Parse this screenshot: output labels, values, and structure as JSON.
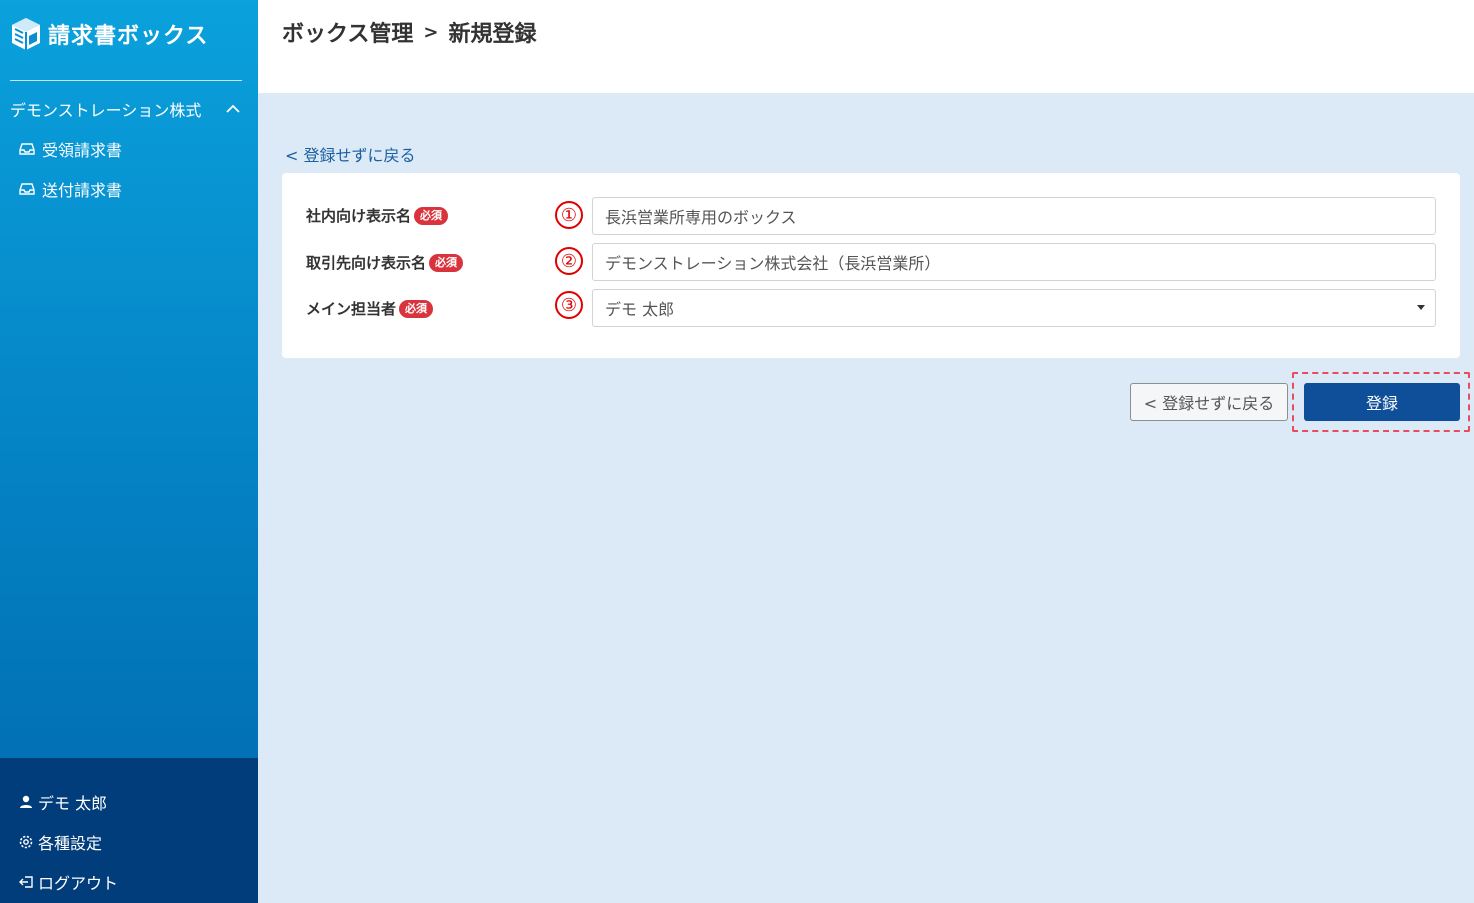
{
  "brand": {
    "name": "請求書ボックス",
    "logo_icon": "box-logo-icon"
  },
  "sidebar": {
    "org_name": "デモンストレーション株式",
    "items": [
      {
        "label": "受領請求書",
        "icon": "inbox-icon"
      },
      {
        "label": "送付請求書",
        "icon": "inbox-icon"
      }
    ],
    "footer": [
      {
        "label": "デモ 太郎",
        "icon": "user-icon"
      },
      {
        "label": "各種設定",
        "icon": "gear-icon"
      },
      {
        "label": "ログアウト",
        "icon": "logout-icon"
      }
    ]
  },
  "header": {
    "breadcrumb_parent": "ボックス管理",
    "separator": ">",
    "breadcrumb_current": "新規登録"
  },
  "back_link": "< 登録せずに戻る",
  "form": {
    "rows": [
      {
        "label": "社内向け表示名",
        "required": "必須",
        "marker": "①",
        "value": "長浜営業所専用のボックス"
      },
      {
        "label": "取引先向け表示名",
        "required": "必須",
        "marker": "②",
        "value": "デモンストレーション株式会社（長浜営業所）"
      },
      {
        "label": "メイン担当者",
        "required": "必須",
        "marker": "③",
        "value": "デモ 太郎"
      }
    ]
  },
  "buttons": {
    "back": "< 登録せずに戻る",
    "submit": "登録"
  },
  "colors": {
    "primary": "#0f4f99",
    "required_badge": "#d9343d",
    "marker_red": "#e00000",
    "link": "#1a5fa0"
  }
}
